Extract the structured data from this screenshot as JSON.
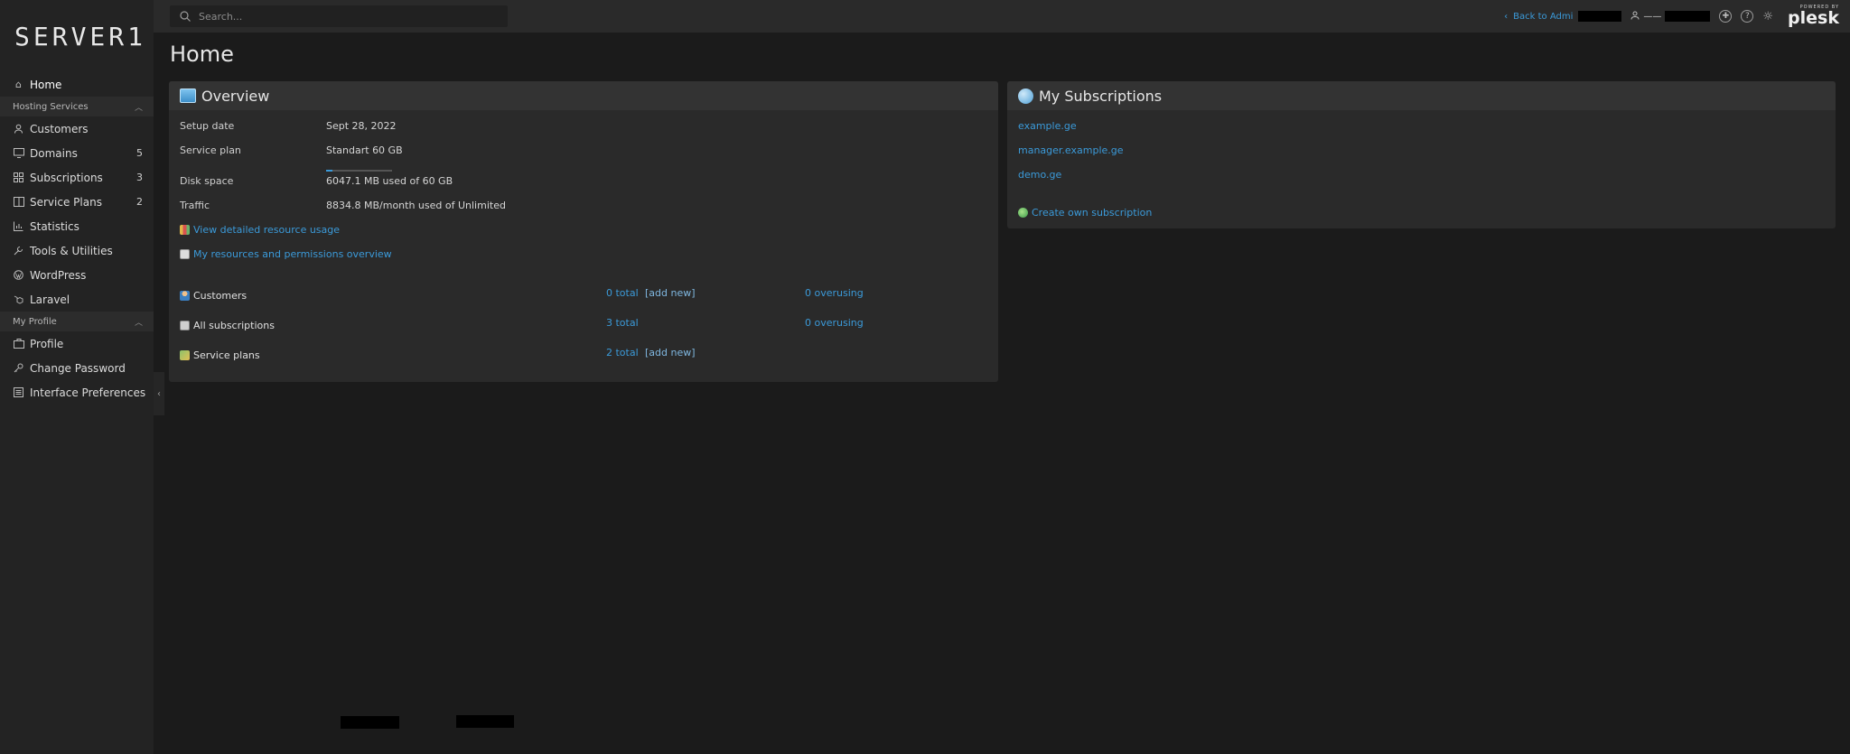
{
  "app": {
    "logo": "SERVER1"
  },
  "topbar": {
    "search_placeholder": "Search...",
    "back_label": "Back to Admi",
    "user_label": "——",
    "powered_by": "POWERED BY",
    "brand": "plesk"
  },
  "sidebar": {
    "items": [
      {
        "label": "Home",
        "icon": "home-icon"
      },
      {
        "section": "Hosting Services"
      },
      {
        "label": "Customers",
        "icon": "user-icon"
      },
      {
        "label": "Domains",
        "icon": "monitor-icon",
        "count": "5"
      },
      {
        "label": "Subscriptions",
        "icon": "grid-icon",
        "count": "3"
      },
      {
        "label": "Service Plans",
        "icon": "book-icon",
        "count": "2"
      },
      {
        "label": "Statistics",
        "icon": "bar-chart-icon"
      },
      {
        "label": "Tools & Utilities",
        "icon": "tools-icon"
      },
      {
        "label": "WordPress",
        "icon": "wordpress-icon"
      },
      {
        "label": "Laravel",
        "icon": "laravel-icon"
      },
      {
        "section": "My Profile"
      },
      {
        "label": "Profile",
        "icon": "profile-icon"
      },
      {
        "label": "Change Password",
        "icon": "key-icon"
      },
      {
        "label": "Interface Preferences",
        "icon": "list-icon"
      }
    ]
  },
  "page": {
    "title": "Home"
  },
  "overview": {
    "title": "Overview",
    "setup_label": "Setup date",
    "setup_value": "Sept 28, 2022",
    "plan_label": "Service plan",
    "plan_value": "Standart 60 GB",
    "disk_label": "Disk space",
    "disk_value": "6047.1 MB used of 60 GB",
    "disk_usage_fraction": 0.098,
    "traffic_label": "Traffic",
    "traffic_value": "8834.8 MB/month used of Unlimited",
    "link_resource": "View detailed resource usage",
    "link_permissions": "My resources and permissions overview",
    "summary": [
      {
        "label": "Customers",
        "total": "0 total",
        "add": "[add new]",
        "over": "0 overusing"
      },
      {
        "label": "All subscriptions",
        "total": "3 total",
        "add": "",
        "over": "0 overusing"
      },
      {
        "label": "Service plans",
        "total": "2 total",
        "add": "[add new]",
        "over": ""
      }
    ]
  },
  "subscriptions": {
    "title": "My Subscriptions",
    "items": [
      "example.ge",
      "manager.example.ge",
      "demo.ge"
    ],
    "create_label": "Create own subscription"
  },
  "colors": {
    "accent": "#3b9ad9",
    "background": "#1b1b1b",
    "sidebar": "#232323",
    "card": "#2a2a2a"
  }
}
